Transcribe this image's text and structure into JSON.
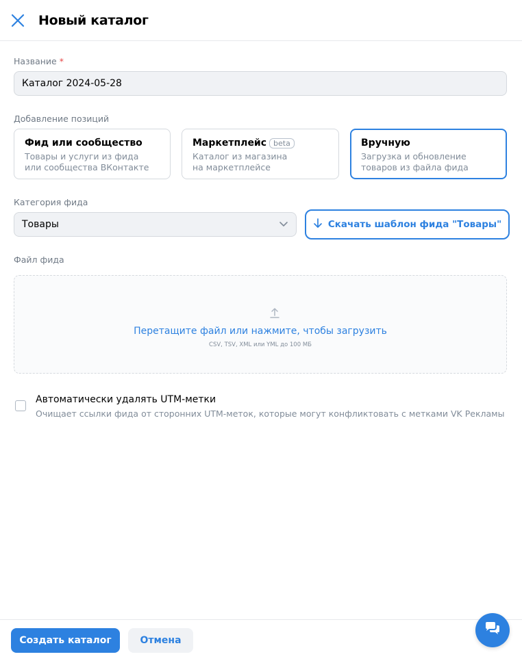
{
  "header": {
    "title": "Новый каталог",
    "close_icon": "close-icon"
  },
  "name_field": {
    "label": "Название",
    "required_mark": "*",
    "value": "Каталог 2024-05-28"
  },
  "positions": {
    "label": "Добавление позиций",
    "options": [
      {
        "title": "Фид или сообщество",
        "desc_line1": "Товары и услуги из фида",
        "desc_line2": "или сообщества ВКонтакте",
        "selected": false
      },
      {
        "title": "Маркетплейс",
        "badge": "beta",
        "desc_line1": "Каталог из магазина",
        "desc_line2": "на маркетплейсе",
        "selected": false
      },
      {
        "title": "Вручную",
        "desc_line1": "Загрузка и обновление",
        "desc_line2": "товаров из файла фида",
        "selected": true
      }
    ]
  },
  "category": {
    "label": "Категория фида",
    "value": "Товары",
    "download_label": "Скачать шаблон фида \"Товары\""
  },
  "file": {
    "label": "Файл фида",
    "dropzone_text": "Перетащите файл или нажмите, чтобы загрузить",
    "dropzone_hint": "CSV, TSV, XML или YML до 100 МБ"
  },
  "utm": {
    "title": "Автоматически удалять UTM-метки",
    "description": "Очищает ссылки фида от сторонних UTM-меток, которые могут конфликтовать с метками VK Рекламы",
    "checked": false
  },
  "footer": {
    "create_label": "Создать каталог",
    "cancel_label": "Отмена"
  },
  "colors": {
    "accent": "#2d81e0",
    "required": "#e64646",
    "muted_text": "#818c99"
  }
}
